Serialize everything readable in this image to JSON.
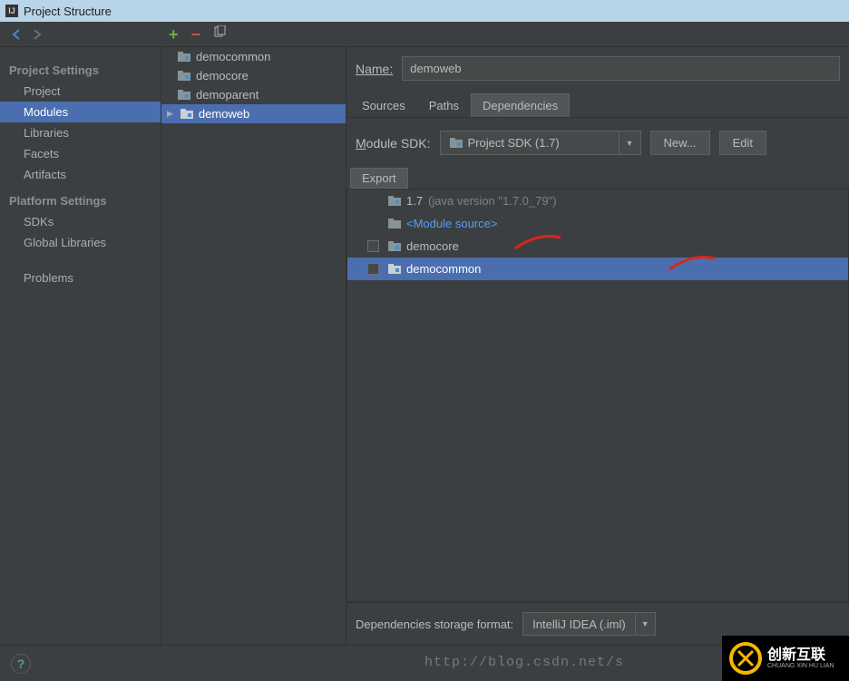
{
  "window_title": "Project Structure",
  "sidebar": {
    "project_settings_header": "Project Settings",
    "project": "Project",
    "modules": "Modules",
    "libraries": "Libraries",
    "facets": "Facets",
    "artifacts": "Artifacts",
    "platform_settings_header": "Platform Settings",
    "sdks": "SDKs",
    "global_libraries": "Global Libraries",
    "problems": "Problems"
  },
  "modules_list": {
    "items": [
      {
        "name": "democommon"
      },
      {
        "name": "democore"
      },
      {
        "name": "demoparent"
      },
      {
        "name": "demoweb"
      }
    ]
  },
  "detail": {
    "name_label": "Name:",
    "name_value": "demoweb",
    "tabs": {
      "sources": "Sources",
      "paths": "Paths",
      "dependencies": "Dependencies"
    },
    "sdk_label_prefix": "M",
    "sdk_label_rest": "odule SDK:",
    "sdk_value": "Project SDK (1.7)",
    "new_btn": "New...",
    "edit_btn": "Edit",
    "export_label": "Export",
    "deps": {
      "jdk_name": "1.7",
      "jdk_ver": "(java version \"1.7.0_79\")",
      "module_source": "<Module source>",
      "democore": "democore",
      "democommon": "democommon"
    },
    "storage_label": "Dependencies storage format:",
    "storage_value": "IntelliJ IDEA (.iml)"
  },
  "watermark": {
    "url": "http://blog.csdn.net/s",
    "brand": "创新互联",
    "brand_sub": "CHUANG XIN HU LIAN"
  }
}
